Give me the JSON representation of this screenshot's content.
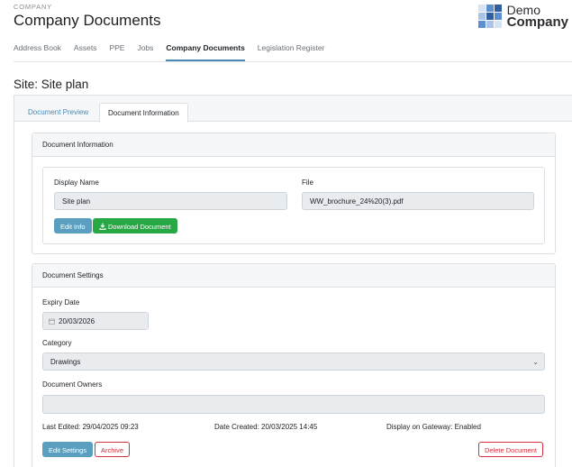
{
  "header": {
    "eyebrow": "COMPANY",
    "title": "Company Documents",
    "logo": {
      "line1": "Demo",
      "line2": "Company",
      "colors": [
        "#2f5f9e",
        "#5b8fd0",
        "#a9c4e6",
        "#d6e3f3"
      ]
    }
  },
  "nav": {
    "tabs": [
      {
        "label": "Address Book",
        "active": false
      },
      {
        "label": "Assets",
        "active": false
      },
      {
        "label": "PPE",
        "active": false
      },
      {
        "label": "Jobs",
        "active": false
      },
      {
        "label": "Company Documents",
        "active": true
      },
      {
        "label": "Legislation Register",
        "active": false
      }
    ]
  },
  "page": {
    "title": "Site: Site plan"
  },
  "doc_tabs": {
    "preview": "Document Preview",
    "info": "Document Information",
    "active": "info"
  },
  "doc_info": {
    "header": "Document Information",
    "display_name_label": "Display Name",
    "display_name_value": "Site plan",
    "file_label": "File",
    "file_value": "WW_brochure_24%20(3).pdf",
    "edit_info_label": "Edit Info",
    "download_label": "Download Document",
    "download_icon": "download-icon"
  },
  "doc_settings": {
    "header": "Document Settings",
    "expiry_label": "Expiry Date",
    "expiry_value": "20/03/2026",
    "calendar_icon": "calendar-icon",
    "category_label": "Category",
    "category_value": "Drawings",
    "owners_label": "Document Owners",
    "owners_value": "",
    "last_edited": "Last Edited: 29/04/2025 09:23",
    "date_created": "Date Created: 20/03/2025 14:45",
    "gateway": "Display on Gateway: Enabled",
    "edit_settings_label": "Edit Settings",
    "archive_label": "Archive",
    "delete_label": "Delete Document"
  },
  "colors": {
    "accent": "#4a8bb3",
    "info_button": "#5b9fc0",
    "success_button": "#28a745",
    "danger": "#d0313f"
  }
}
